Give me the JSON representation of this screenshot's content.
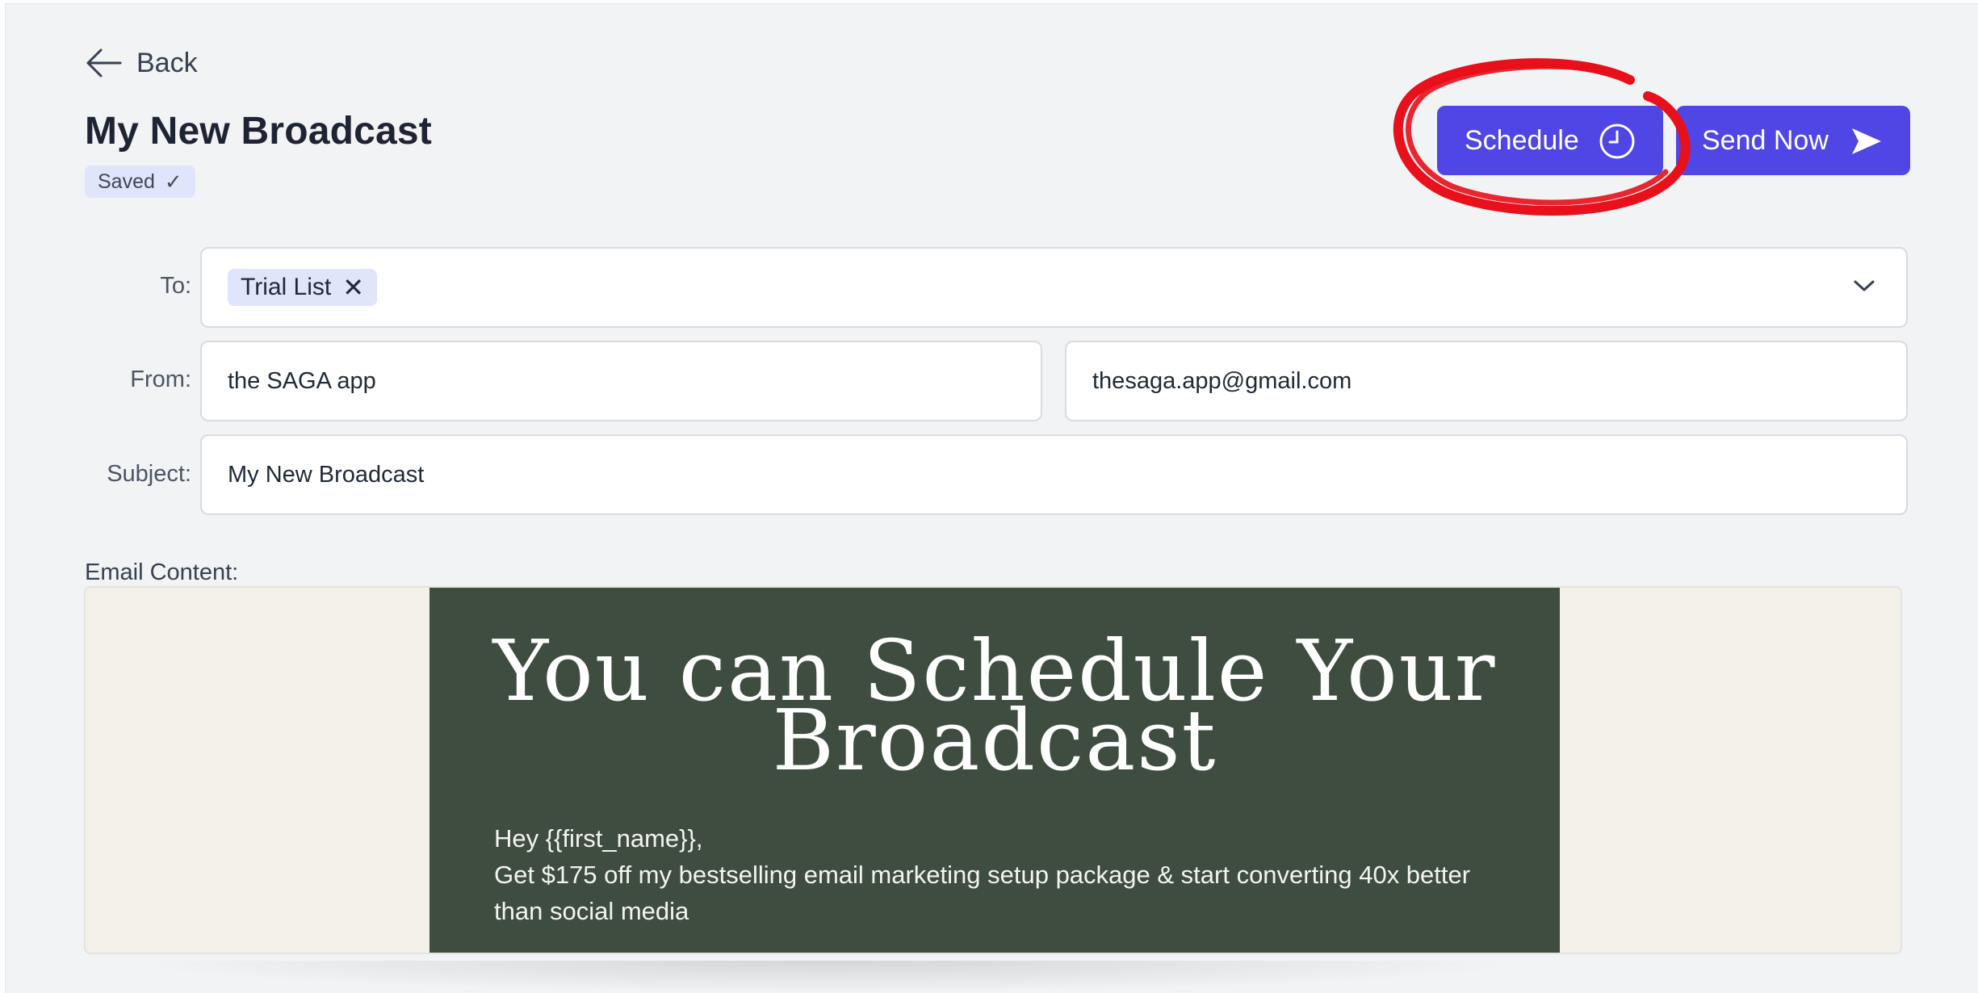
{
  "header": {
    "back_label": "Back",
    "title": "My New Broadcast",
    "saved_label": "Saved",
    "saved_icon": "checkmark-icon"
  },
  "actions": {
    "schedule_label": "Schedule",
    "schedule_icon": "clock-icon",
    "send_label": "Send Now",
    "send_icon": "paper-plane-icon",
    "button_color": "#4f46e5"
  },
  "annotation": {
    "color": "#e8101a",
    "shape": "hand-drawn circle around Schedule button"
  },
  "form": {
    "to_label": "To:",
    "to_tags": [
      "Trial List"
    ],
    "from_label": "From:",
    "from_name": "the SAGA app",
    "from_email": "thesaga.app@gmail.com",
    "subject_label": "Subject:",
    "subject_value": "My New Broadcast"
  },
  "email": {
    "content_label": "Email Content:",
    "heading": "You can Schedule Your Broadcast",
    "greeting": "Hey {{first_name}},",
    "body": "Get $175 off my bestselling email marketing setup package & start converting 40x better than social media",
    "card_color": "#3f4d40",
    "background_color": "#f2f0e9"
  }
}
